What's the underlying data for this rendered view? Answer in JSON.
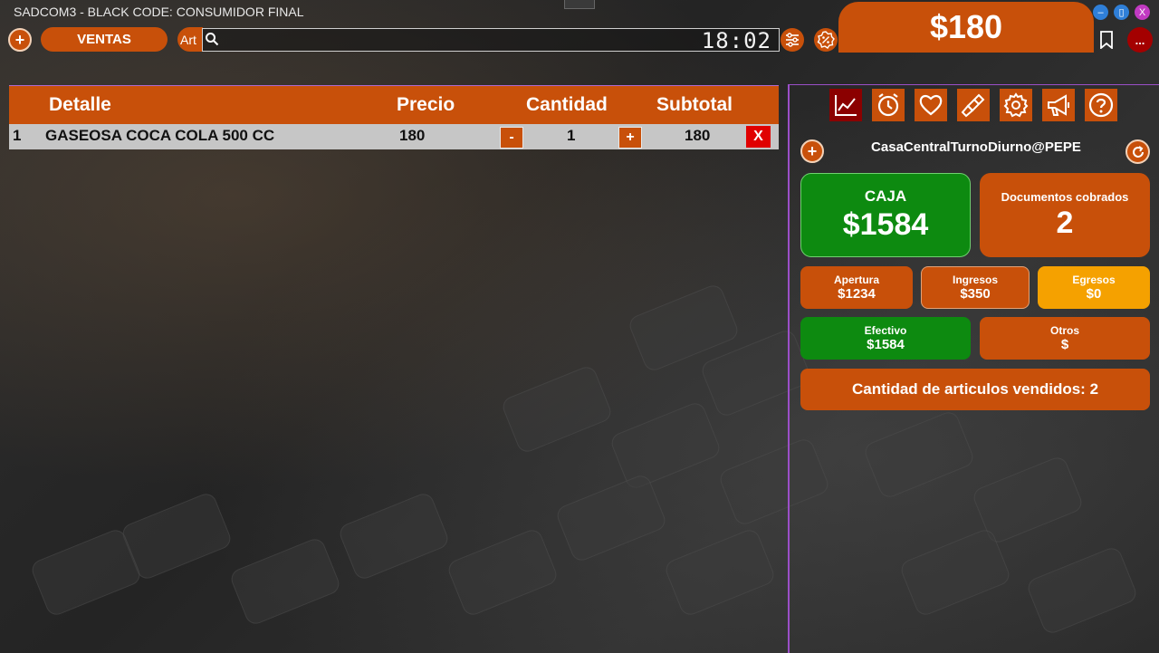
{
  "window": {
    "title": "SADCOM3 - BLACK CODE: CONSUMIDOR FINAL",
    "controls": {
      "minimize": "–",
      "maximize": "▯",
      "close": "X"
    }
  },
  "toolbar": {
    "add_label": "+",
    "ventas_label": "VENTAS",
    "art_label": "Art",
    "search_value": "",
    "search_placeholder": "",
    "clock": "18:02",
    "total": "$180",
    "more_label": "..."
  },
  "table": {
    "headers": [
      "Detalle",
      "Precio",
      "Cantidad",
      "Subtotal"
    ],
    "rows": [
      {
        "index": "1",
        "detail": "GASEOSA COCA COLA 500 CC",
        "price": "180",
        "qty": "1",
        "subtotal": "180"
      }
    ],
    "minus_label": "-",
    "plus_label": "+",
    "delete_label": "X"
  },
  "panel": {
    "tools": [
      "chart-icon",
      "alarm-icon",
      "heart-icon",
      "brush-icon",
      "gear-icon",
      "megaphone-icon",
      "help-icon"
    ],
    "session": "CasaCentralTurnoDiurno@PEPE",
    "caja": {
      "label": "CAJA",
      "value": "$1584"
    },
    "documentos": {
      "label": "Documentos cobrados",
      "value": "2"
    },
    "apertura": {
      "label": "Apertura",
      "value": "$1234"
    },
    "ingresos": {
      "label": "Ingresos",
      "value": "$350"
    },
    "egresos": {
      "label": "Egresos",
      "value": "$0"
    },
    "efectivo": {
      "label": "Efectivo",
      "value": "$1584"
    },
    "otros": {
      "label": "Otros",
      "value": "$"
    },
    "vendidos": "Cantidad de articulos vendidos: 2"
  },
  "colors": {
    "accent": "#c8500a",
    "green": "#0d8a10",
    "yellow": "#f5a100",
    "danger": "#e00000",
    "dark_red": "#8b0000"
  }
}
